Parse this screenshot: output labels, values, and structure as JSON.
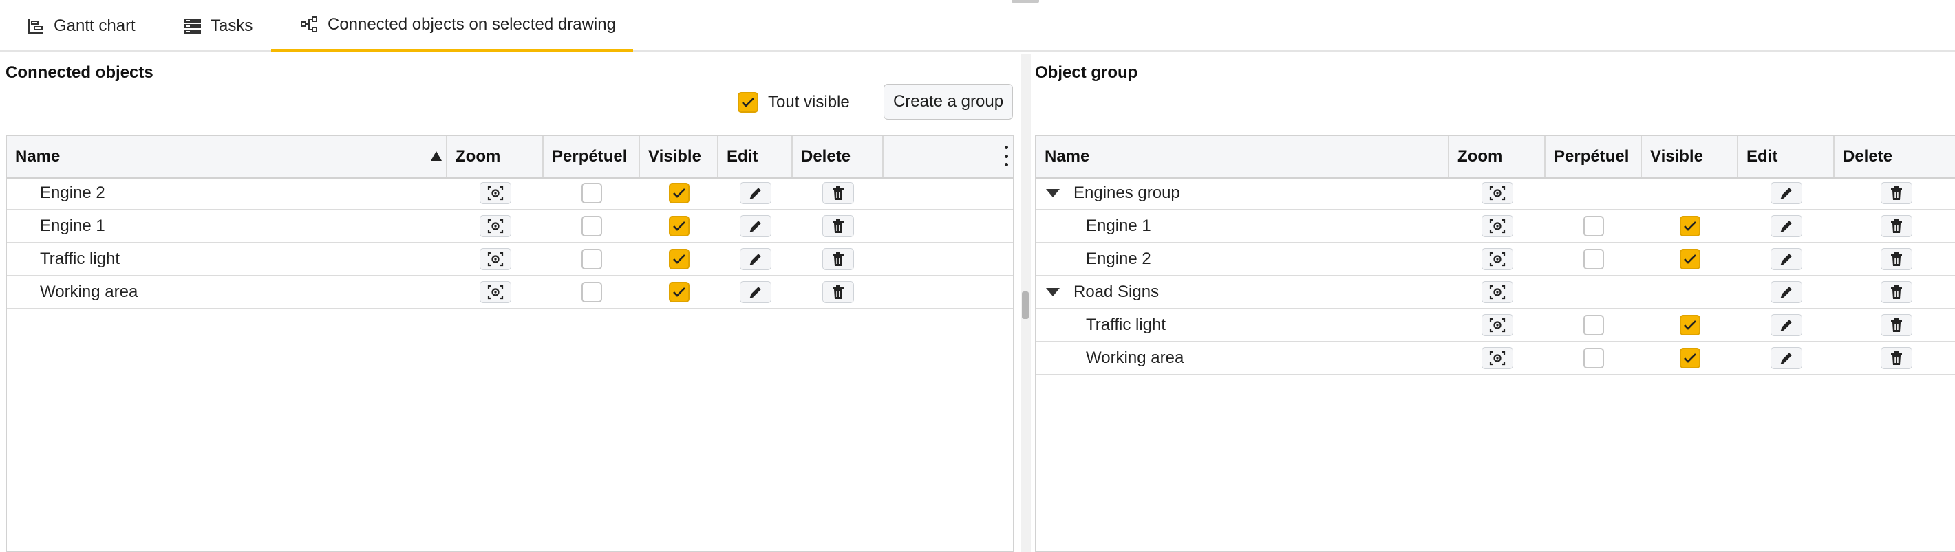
{
  "tabs": [
    {
      "label": "Gantt chart",
      "icon": "gantt-icon",
      "active": false
    },
    {
      "label": "Tasks",
      "icon": "tasks-icon",
      "active": false
    },
    {
      "label": "Connected objects on selected drawing",
      "icon": "connected-objects-icon",
      "active": true
    }
  ],
  "left_panel": {
    "title": "Connected objects",
    "toggle_all": {
      "label": "Tout visible",
      "checked": true
    },
    "create_group_label": "Create a group",
    "columns": [
      "Name",
      "Zoom",
      "Perpétuel",
      "Visible",
      "Edit",
      "Delete"
    ],
    "sort_column": "Name",
    "sort_direction": "ascending",
    "rows": [
      {
        "name": "Engine 2",
        "perpetuel": false,
        "visible": true
      },
      {
        "name": "Engine 1",
        "perpetuel": false,
        "visible": true
      },
      {
        "name": "Traffic light",
        "perpetuel": false,
        "visible": true
      },
      {
        "name": "Working area",
        "perpetuel": false,
        "visible": true
      }
    ]
  },
  "right_panel": {
    "title": "Object group",
    "columns": [
      "Name",
      "Zoom",
      "Perpétuel",
      "Visible",
      "Edit",
      "Delete"
    ],
    "rows": [
      {
        "name": "Engines group",
        "group": true,
        "expanded": true
      },
      {
        "name": "Engine 1",
        "group": false,
        "perpetuel": false,
        "visible": true
      },
      {
        "name": "Engine 2",
        "group": false,
        "perpetuel": false,
        "visible": true
      },
      {
        "name": "Road Signs",
        "group": true,
        "expanded": true
      },
      {
        "name": "Traffic light",
        "group": false,
        "perpetuel": false,
        "visible": true
      },
      {
        "name": "Working area",
        "group": false,
        "perpetuel": false,
        "visible": true
      }
    ]
  },
  "colors": {
    "accent": "#f7b500",
    "header_bg": "#f5f6f8",
    "border": "#d2d2d2"
  },
  "icons": {
    "zoom": "zoom-focus-icon",
    "edit": "pencil-icon",
    "delete": "trash-icon",
    "check": "check-icon",
    "menu": "kebab-menu-icon",
    "expand": "caret-down-icon"
  }
}
